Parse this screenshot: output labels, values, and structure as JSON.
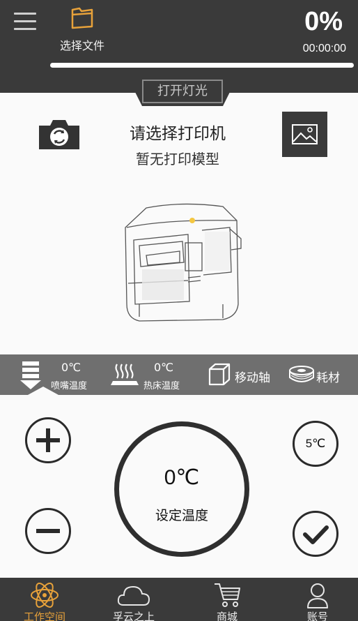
{
  "header": {
    "open_file_label": "选择文件",
    "progress_percent": "0%",
    "progress_value": 0,
    "elapsed_time": "00:00:00"
  },
  "light_toggle_label": "打开灯光",
  "main": {
    "printer_title": "请选择打印机",
    "model_status": "暂无打印模型"
  },
  "tabs": {
    "nozzle": {
      "value": "0℃",
      "label": "喷嘴温度"
    },
    "bed": {
      "value": "0℃",
      "label": "热床温度"
    },
    "move_axis": {
      "label": "移动轴"
    },
    "filament": {
      "label": "耗材"
    }
  },
  "controls": {
    "step_label": "5℃",
    "set_temp_value": "0℃",
    "set_temp_label": "设定温度"
  },
  "nav": {
    "workspace": "工作空间",
    "cloud": "孚云之上",
    "mall": "商城",
    "account": "账号"
  },
  "colors": {
    "header_bg": "#3a3a3a",
    "accent": "#e8a23a",
    "tab_strip_bg": "#6f6f6f"
  },
  "icons": [
    "menu-icon",
    "folder-icon",
    "camera-rotate-icon",
    "image-icon",
    "nozzle-icon",
    "heated-bed-icon",
    "cube-icon",
    "filament-spool-icon",
    "plus-icon",
    "minus-icon",
    "check-icon",
    "atom-icon",
    "cloud-icon",
    "cart-icon",
    "user-icon"
  ]
}
